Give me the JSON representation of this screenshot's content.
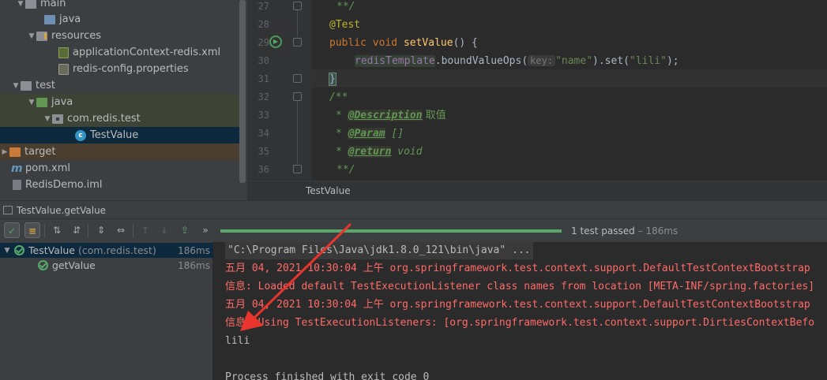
{
  "project_tree": {
    "items": [
      {
        "label": "main"
      },
      {
        "label": "java"
      },
      {
        "label": "resources"
      },
      {
        "label": "applicationContext-redis.xml"
      },
      {
        "label": "redis-config.properties"
      },
      {
        "label": "test"
      },
      {
        "label": "java"
      },
      {
        "label": "com.redis.test"
      },
      {
        "label": "TestValue"
      },
      {
        "label": "target"
      },
      {
        "label": "pom.xml"
      },
      {
        "label": "RedisDemo.iml"
      }
    ]
  },
  "editor": {
    "line_numbers": [
      "27",
      "28",
      "29",
      "30",
      "31",
      "32",
      "33",
      "34",
      "35",
      "36"
    ],
    "code": {
      "l27": "**/",
      "l28_annotation": "@Test",
      "l29_kw1": "public",
      "l29_kw2": "void",
      "l29_method": "setValue",
      "l29_rest": "() {",
      "l30_field": "redisTemplate",
      "l30_call": ".boundValueOps(",
      "l30_hint": "key:",
      "l30_str1": "\"name\"",
      "l30_call2": ").set(",
      "l30_str2": "\"lili\"",
      "l30_end": ");",
      "l31_brace": "}",
      "l32": "/**",
      "l33_star": "* ",
      "l33_tag": "@Description",
      "l33_text": " 取值",
      "l34_star": "* ",
      "l34_tag": "@Param",
      "l34_text": " []",
      "l35_star": "* ",
      "l35_tag": "@return",
      "l35_text": " void",
      "l36": "**/"
    },
    "footer_file": "TestValue"
  },
  "run_panel": {
    "tab_title": "TestValue.getValue",
    "toolbar_more": "»",
    "progress_fraction": 1.0,
    "status_text": "1 test passed",
    "status_sep": " – ",
    "status_time": "186ms",
    "tests": [
      {
        "name": "TestValue",
        "package": "(com.redis.test)",
        "duration": "186ms"
      },
      {
        "name": "getValue",
        "duration": "186ms"
      }
    ],
    "console_lines": [
      "\"C:\\Program Files\\Java\\jdk1.8.0_121\\bin\\java\" ...",
      "五月 04, 2021 10:30:04 上午 org.springframework.test.context.support.DefaultTestContextBootstrap",
      "信息: Loaded default TestExecutionListener class names from location [META-INF/spring.factories]",
      "五月 04, 2021 10:30:04 上午 org.springframework.test.context.support.DefaultTestContextBootstrap",
      "信息: Using TestExecutionListeners: [org.springframework.test.context.support.DirtiesContextBefo",
      "lili",
      "",
      "Process finished with exit code 0"
    ]
  },
  "colors": {
    "annotation_arrow": "#e8352e",
    "pass_green": "#59a869"
  }
}
